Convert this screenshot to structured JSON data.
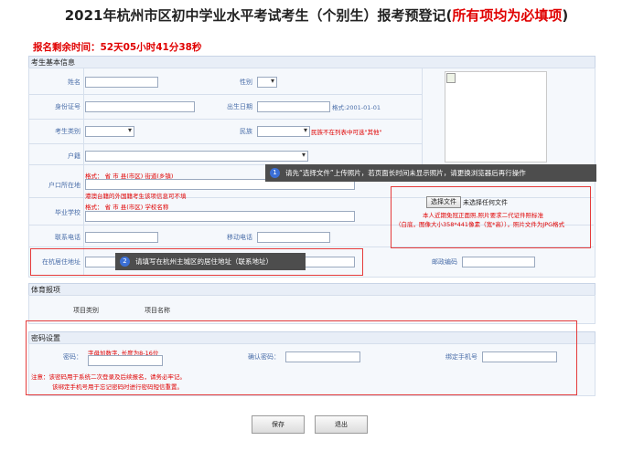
{
  "page": {
    "title": "2021年杭州市区初中学业水平考试考生（个别生）报考预登记(",
    "title_required": "所有项均为必填项",
    "title_end": ")",
    "countdown": "报名剩余时间：52天05小时41分38秒"
  },
  "basic": {
    "section_title": "考生基本信息",
    "name_label": "姓名",
    "gender_label": "性别",
    "id_label": "身份证号",
    "birth_label": "出生日期",
    "birth_hint": "格式:2001-01-01",
    "category_label": "考生类别",
    "ethnic_label": "民族",
    "ethnic_hint": "民族不在列表中可选\"其他\"",
    "hukou_label": "户籍",
    "hukou_addr_label": "户口所在地",
    "hukou_addr_format": "格式：  省     市     县(市区)    街道(乡镇)",
    "hukou_addr_hint": "港澳台籍的外国籍考生该项信息可不填",
    "school_label": "毕业学校",
    "school_format": "格式：  省     市     县(市区)    学校名称",
    "contact_label": "联系电话",
    "mobile_label": "移动电话",
    "residence_label": "在杭居住地址",
    "postcode_label": "邮政编码"
  },
  "photo": {
    "choose_btn": "选择文件",
    "no_file": "未选择任何文件",
    "hint1": "本人近期免冠正面照,照片要求二代证件照标准",
    "hint2": "（白底，图像大小358*441像素（宽*高）），照片文件为JPG格式"
  },
  "tips": {
    "tip1_num": "1",
    "tip1": "请先“选择文件”上传照片，若页面长时间未显示照片，请更换浏览器后再行操作",
    "tip2_num": "2",
    "tip2": "请填写在杭州主城区的居住地址（联系地址）"
  },
  "sports": {
    "section_title": "体育报项",
    "col_category": "项目类别",
    "col_name": "项目名称"
  },
  "password": {
    "section_title": "密码设置",
    "pwd_label": "密码：",
    "pwd_hint": "字母加数字, 长度为8-16位",
    "confirm_label": "确认密码：",
    "phone_label": "绑定手机号",
    "note1": "注意：该密码用于系统二次登录及后续报名，请务必牢记。",
    "note2": "该绑定手机号用于忘记密码时进行密码短信重置。"
  },
  "actions": {
    "save": "保存",
    "exit": "退出"
  }
}
